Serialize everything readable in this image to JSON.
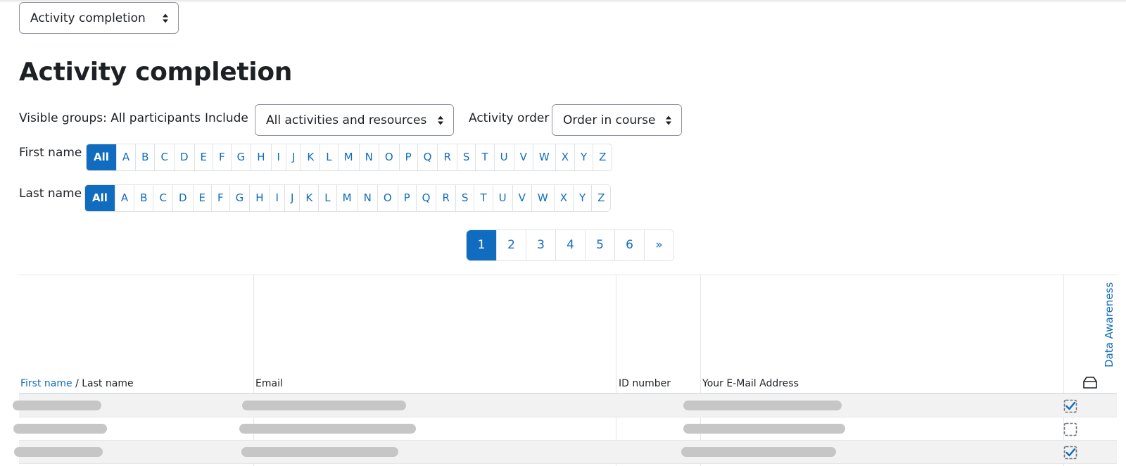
{
  "report_select": {
    "value": "Activity completion"
  },
  "page_title": "Activity completion",
  "filters": {
    "visible_groups": "Visible groups: All participants",
    "include_label": "Include",
    "include_value": "All activities and resources",
    "order_label": "Activity order",
    "order_value": "Order in course"
  },
  "first_name_bar": {
    "label": "First name",
    "letters": [
      "All",
      "A",
      "B",
      "C",
      "D",
      "E",
      "F",
      "G",
      "H",
      "I",
      "J",
      "K",
      "L",
      "M",
      "N",
      "O",
      "P",
      "Q",
      "R",
      "S",
      "T",
      "U",
      "V",
      "W",
      "X",
      "Y",
      "Z"
    ]
  },
  "last_name_bar": {
    "label": "Last name",
    "letters": [
      "All",
      "A",
      "B",
      "C",
      "D",
      "E",
      "F",
      "G",
      "H",
      "I",
      "J",
      "K",
      "L",
      "M",
      "N",
      "O",
      "P",
      "Q",
      "R",
      "S",
      "T",
      "U",
      "V",
      "W",
      "X",
      "Y",
      "Z"
    ]
  },
  "pagination": {
    "pages": [
      "1",
      "2",
      "3",
      "4",
      "5",
      "6",
      "»"
    ],
    "current": "1"
  },
  "table": {
    "col_first_name": "First name",
    "col_sep": " / ",
    "col_last_name": "Last name",
    "col_email": "Email",
    "col_id": "ID number",
    "col_your_email": "Your E-Mail Address",
    "activity_name": "Data Awareness",
    "rows": [
      {
        "completed": true
      },
      {
        "completed": false
      },
      {
        "completed": true
      }
    ]
  },
  "colors": {
    "accent": "#0f6cbf"
  }
}
